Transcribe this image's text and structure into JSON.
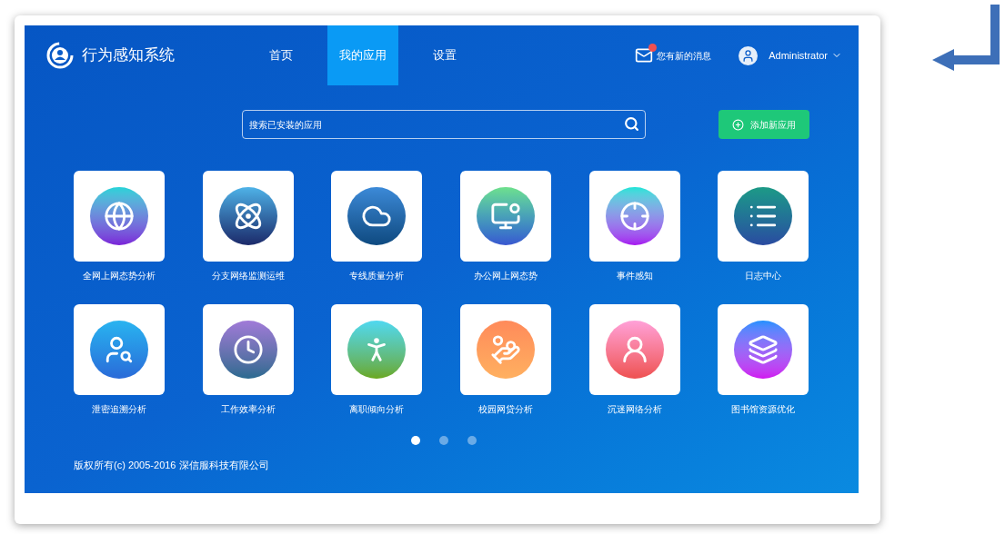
{
  "app_title": "行为感知系统",
  "nav": [
    {
      "label": "首页",
      "selected": false
    },
    {
      "label": "我的应用",
      "selected": true
    },
    {
      "label": "设置",
      "selected": false
    }
  ],
  "messages": {
    "label": "您有新的消息",
    "unread": true
  },
  "user": {
    "name": "Administrator"
  },
  "search": {
    "placeholder": "搜索已安装的应用"
  },
  "add_button": "添加新应用",
  "apps": [
    {
      "label": "全网上网态势分析"
    },
    {
      "label": "分支网络监测运维"
    },
    {
      "label": "专线质量分析"
    },
    {
      "label": "办公网上网态势"
    },
    {
      "label": "事件感知"
    },
    {
      "label": "日志中心"
    },
    {
      "label": "泄密追溯分析"
    },
    {
      "label": "工作效率分析"
    },
    {
      "label": "离职倾向分析"
    },
    {
      "label": "校园网贷分析"
    },
    {
      "label": "沉迷网络分析"
    },
    {
      "label": "图书馆资源优化"
    }
  ],
  "pages": [
    {
      "selected": true
    },
    {
      "selected": false
    },
    {
      "selected": false
    }
  ],
  "copyright": "版权所有(c) 2005-2016 深信服科技有限公司"
}
